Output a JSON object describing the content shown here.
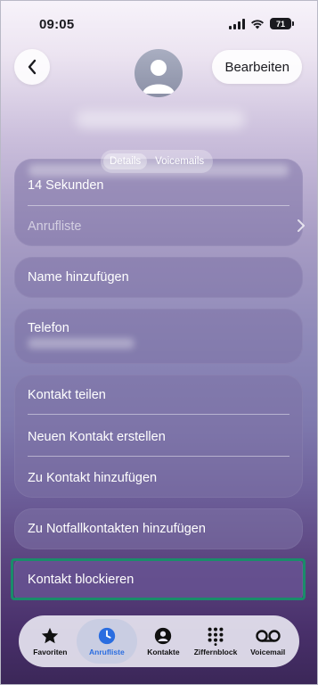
{
  "status_bar": {
    "time": "09:05",
    "battery": "71"
  },
  "header": {
    "back_icon": "chevron-left-icon",
    "edit_label": "Bearbeiten"
  },
  "segmented": {
    "items": [
      "Details",
      "Voicemails"
    ],
    "active": 0
  },
  "call_card": {
    "duration": "14 Sekunden",
    "call_list_label": "Anrufliste"
  },
  "add_name": {
    "label": "Name hinzufügen"
  },
  "phone": {
    "label": "Telefon"
  },
  "actions": [
    {
      "label": "Kontakt teilen"
    },
    {
      "label": "Neuen Kontakt erstellen"
    },
    {
      "label": "Zu Kontakt hinzufügen"
    }
  ],
  "emergency": {
    "label": "Zu Notfallkontakten hinzufügen"
  },
  "block": {
    "label": "Kontakt blockieren",
    "highlight_color": "#1a8c6a"
  },
  "tabs": [
    {
      "label": "Favoriten",
      "icon": "star-icon"
    },
    {
      "label": "Anrufliste",
      "icon": "clock-icon",
      "active": true
    },
    {
      "label": "Kontakte",
      "icon": "person-icon"
    },
    {
      "label": "Ziffernblock",
      "icon": "keypad-icon"
    },
    {
      "label": "Voicemail",
      "icon": "voicemail-icon"
    }
  ],
  "colors": {
    "accent": "#2a6de0",
    "highlight": "#1a8c6a"
  }
}
